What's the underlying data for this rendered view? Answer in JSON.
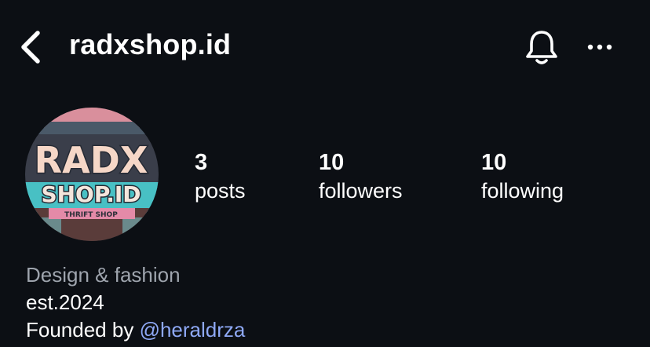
{
  "header": {
    "username": "radxshop.id",
    "icons": {
      "back": "chevron-left-icon",
      "notifications": "bell-icon",
      "more": "more-horizontal-icon"
    }
  },
  "profile": {
    "avatar_text_line1": "RADX",
    "avatar_text_line2": "SHOP.ID",
    "avatar_subtext": "THRIFT SHOP",
    "stats": [
      {
        "count": "3",
        "label": "posts"
      },
      {
        "count": "10",
        "label": "followers"
      },
      {
        "count": "10",
        "label": "following"
      }
    ],
    "bio": {
      "category": "Design & fashion",
      "line2": "est.2024",
      "founded_prefix": "Founded by",
      "founded_mention": "@heraldrza"
    }
  },
  "colors": {
    "background": "#0c0f14",
    "text": "#ffffff",
    "muted": "#9ea4ad",
    "link": "#8ea8f5"
  }
}
